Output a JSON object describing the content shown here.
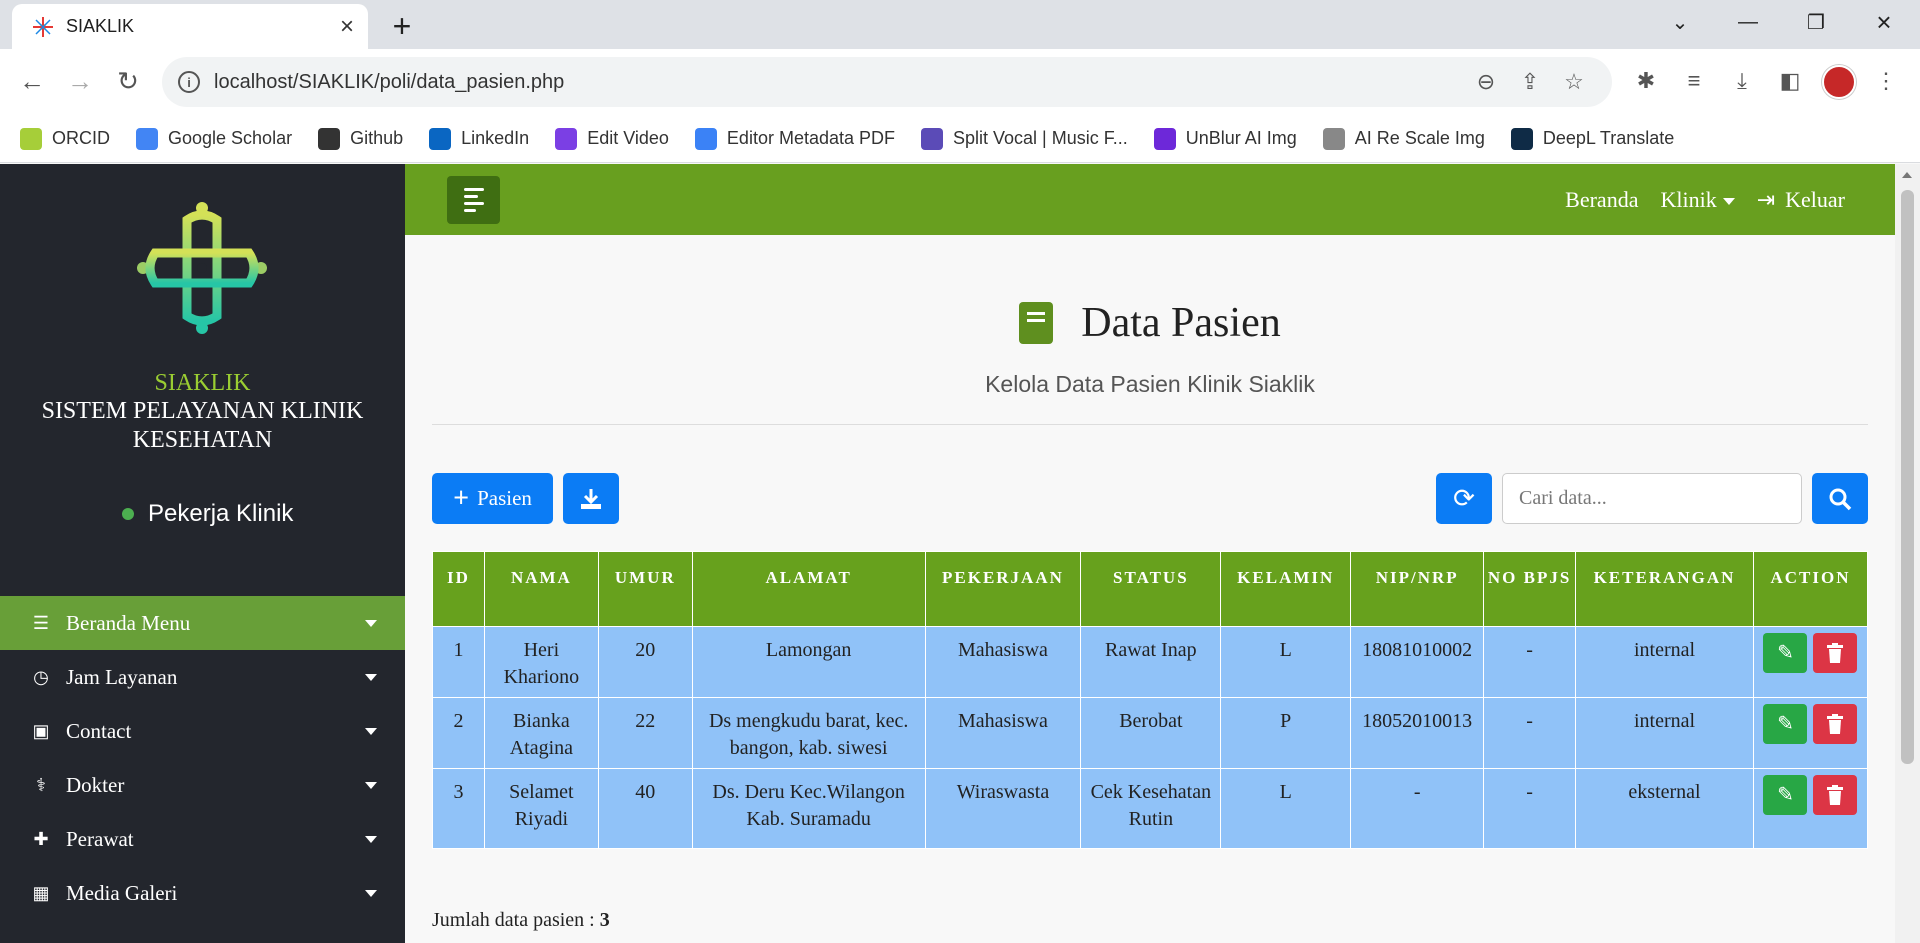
{
  "browser": {
    "tab_title": "SIAKLIK",
    "url": "localhost/SIAKLIK/poli/data_pasien.php",
    "bookmarks": [
      {
        "label": "ORCID",
        "icon": "orcid-icon",
        "color": "#a6ce39"
      },
      {
        "label": "Google Scholar",
        "icon": "scholar-icon",
        "color": "#4285f4"
      },
      {
        "label": "Github",
        "icon": "github-icon",
        "color": "#333333"
      },
      {
        "label": "LinkedIn",
        "icon": "linkedin-icon",
        "color": "#0a66c2"
      },
      {
        "label": "Edit Video",
        "icon": "video-icon",
        "color": "#7b3fe4"
      },
      {
        "label": "Editor Metadata PDF",
        "icon": "pdf-icon",
        "color": "#3b82f6"
      },
      {
        "label": "Split Vocal | Music F...",
        "icon": "vocal-icon",
        "color": "#5b4bb7"
      },
      {
        "label": "UnBlur AI Img",
        "icon": "unblur-icon",
        "color": "#6d28d9"
      },
      {
        "label": "AI Re Scale Img",
        "icon": "rescale-icon",
        "color": "#888888"
      },
      {
        "label": "DeepL Translate",
        "icon": "deepl-icon",
        "color": "#0f2b46"
      }
    ]
  },
  "sidebar": {
    "app_name": "SIAKLIK",
    "app_subtitle_line1": "SISTEM PELAYANAN KLINIK",
    "app_subtitle_line2": "KESEHATAN",
    "user_status": "Pekerja Klinik",
    "menu": [
      {
        "label": "Beranda Menu",
        "icon": "list-icon",
        "glyph": "☰",
        "active": true
      },
      {
        "label": "Jam Layanan",
        "icon": "clock-icon",
        "glyph": "◷",
        "active": false
      },
      {
        "label": "Contact",
        "icon": "contact-icon",
        "glyph": "▣",
        "active": false
      },
      {
        "label": "Dokter",
        "icon": "stethoscope-icon",
        "glyph": "⚕",
        "active": false
      },
      {
        "label": "Perawat",
        "icon": "medkit-icon",
        "glyph": "✚",
        "active": false
      },
      {
        "label": "Media Galeri",
        "icon": "gallery-icon",
        "glyph": "▦",
        "active": false
      }
    ]
  },
  "topnav": {
    "home": "Beranda",
    "clinic": "Klinik",
    "logout": "Keluar"
  },
  "header": {
    "title": "Data Pasien",
    "subtitle": "Kelola Data Pasien Klinik Siaklik"
  },
  "actions": {
    "add_label": "Pasien",
    "search_placeholder": "Cari data..."
  },
  "table": {
    "columns": [
      "ID",
      "NAMA",
      "UMUR",
      "ALAMAT",
      "PEKERJAAN",
      "STATUS",
      "KELAMIN",
      "NIP/NRP",
      "NO BPJS",
      "KETERANGAN",
      "ACTION"
    ],
    "rows": [
      {
        "id": "1",
        "nama": "Heri Khariono",
        "umur": "20",
        "alamat": "Lamongan",
        "pekerjaan": "Mahasiswa",
        "status": "Rawat Inap",
        "kelamin": "L",
        "nip": "18081010002",
        "bpjs": "-",
        "ket": "internal"
      },
      {
        "id": "2",
        "nama": "Bianka Atagina",
        "umur": "22",
        "alamat": "Ds mengkudu barat, kec. bangon, kab. siwesi",
        "pekerjaan": "Mahasiswa",
        "status": "Berobat",
        "kelamin": "P",
        "nip": "18052010013",
        "bpjs": "-",
        "ket": "internal"
      },
      {
        "id": "3",
        "nama": "Selamet Riyadi",
        "umur": "40",
        "alamat": "Ds. Deru Kec.Wilangon Kab. Suramadu",
        "pekerjaan": "Wiraswasta",
        "status": "Cek Kesehatan Rutin",
        "kelamin": "L",
        "nip": "-",
        "bpjs": "-",
        "ket": "eksternal"
      }
    ]
  },
  "footer": {
    "count_label": "Jumlah data pasien : ",
    "count_value": "3"
  },
  "colors": {
    "primary_green": "#689f1f",
    "sidebar_bg": "#23262d",
    "button_blue": "#0b7cf5",
    "row_blue": "#90c2f8"
  }
}
